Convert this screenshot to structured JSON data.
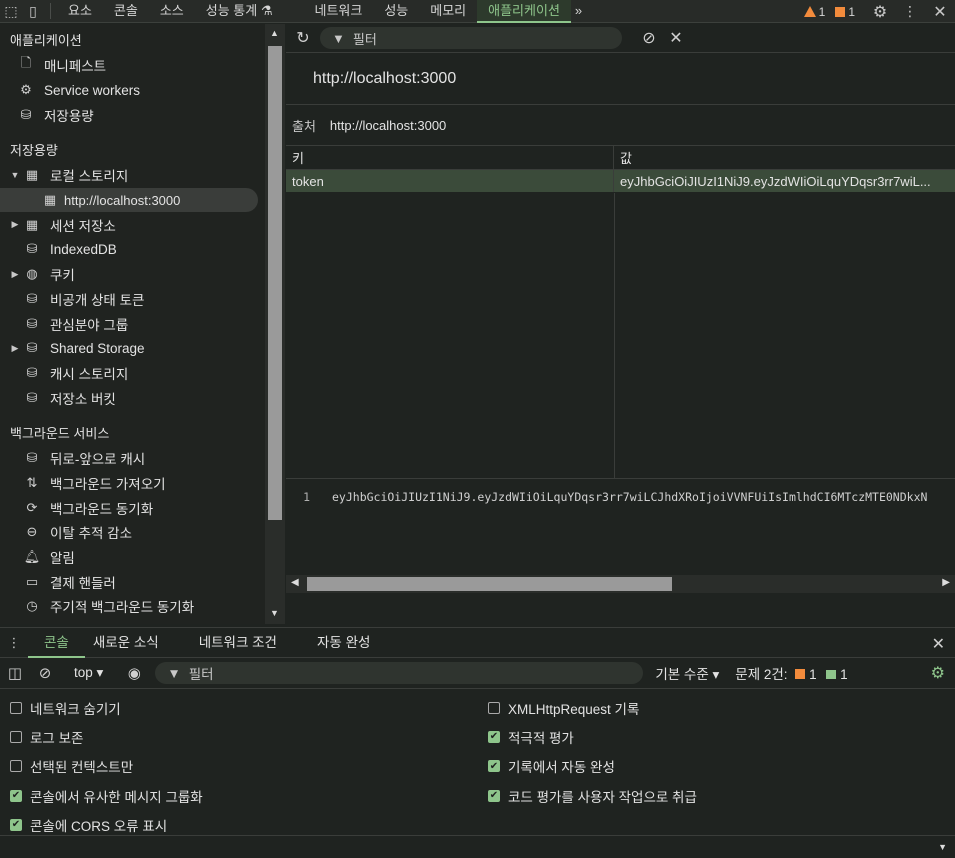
{
  "topbar": {
    "tabs": [
      "요소",
      "콘솔",
      "소스",
      "성능 통계 ⚗",
      "네트워크",
      "성능",
      "메모리",
      "애플리케이션"
    ],
    "more": "»",
    "warnings": "1",
    "issues": "1"
  },
  "sidebar": {
    "sections": [
      {
        "title": "애플리케이션",
        "items": [
          {
            "label": "매니페스트",
            "icon": "file-icon"
          },
          {
            "label": "Service workers",
            "icon": "gears-icon"
          },
          {
            "label": "저장용량",
            "icon": "database-icon"
          }
        ]
      },
      {
        "title": "저장용량",
        "items": [
          {
            "label": "로컬 스토리지",
            "icon": "table-icon",
            "arrow": "▼"
          },
          {
            "label": "http://localhost:3000",
            "icon": "table-icon",
            "selected": true,
            "indent": true
          },
          {
            "label": "세션 저장소",
            "icon": "table-icon",
            "arrow": "▶"
          },
          {
            "label": "IndexedDB",
            "icon": "database-icon"
          },
          {
            "label": "쿠키",
            "icon": "cookie-icon",
            "arrow": "▶"
          },
          {
            "label": "비공개 상태 토큰",
            "icon": "database-icon"
          },
          {
            "label": "관심분야 그룹",
            "icon": "database-icon"
          },
          {
            "label": "Shared Storage",
            "icon": "database-icon",
            "arrow": "▶"
          },
          {
            "label": "캐시 스토리지",
            "icon": "database-icon"
          },
          {
            "label": "저장소 버킷",
            "icon": "database-icon"
          }
        ]
      },
      {
        "title": "백그라운드 서비스",
        "items": [
          {
            "label": "뒤로-앞으로 캐시",
            "icon": "database-icon"
          },
          {
            "label": "백그라운드 가져오기",
            "icon": "fetch-icon"
          },
          {
            "label": "백그라운드 동기화",
            "icon": "sync-icon"
          },
          {
            "label": "이탈 추적 감소",
            "icon": "bounce-icon"
          },
          {
            "label": "알림",
            "icon": "bell-icon"
          },
          {
            "label": "결제 핸들러",
            "icon": "card-icon"
          },
          {
            "label": "주기적 백그라운드 동기화",
            "icon": "clock-icon"
          }
        ]
      }
    ]
  },
  "main": {
    "filter_placeholder": "필터",
    "origin_title": "http://localhost:3000",
    "origin_label": "출처",
    "origin_value": "http://localhost:3000",
    "columns": [
      "키",
      "값"
    ],
    "rows": [
      {
        "key": "token",
        "value": "eyJhbGciOiJIUzI1NiJ9.eyJzdWIiOiLquYDqsr3rr7wiL..."
      }
    ],
    "value_line_number": "1",
    "value_full": "eyJhbGciOiJIUzI1NiJ9.eyJzdWIiOiLquYDqsr3rr7wiLCJhdXRoIjoiVVNFUiIsImlhdCI6MTczMTE0NDkxN"
  },
  "drawer": {
    "tabs": [
      "콘솔",
      "새로운 소식",
      "네트워크 조건",
      "자동 완성"
    ],
    "context": "top",
    "filter_placeholder": "필터",
    "level": "기본 수준",
    "issues_label": "문제 2건:",
    "issues_warn": "1",
    "issues_info": "1",
    "settings_left": [
      {
        "label": "네트워크 숨기기",
        "checked": false
      },
      {
        "label": "로그 보존",
        "checked": false
      },
      {
        "label": "선택된 컨텍스트만",
        "checked": false
      },
      {
        "label": "콘솔에서 유사한 메시지 그룹화",
        "checked": true
      },
      {
        "label": "콘솔에 CORS 오류 표시",
        "checked": true
      }
    ],
    "settings_right": [
      {
        "label": "XMLHttpRequest 기록",
        "checked": false
      },
      {
        "label": "적극적 평가",
        "checked": true
      },
      {
        "label": "기록에서 자동 완성",
        "checked": true
      },
      {
        "label": "코드 평가를 사용자 작업으로 취급",
        "checked": true
      }
    ]
  }
}
